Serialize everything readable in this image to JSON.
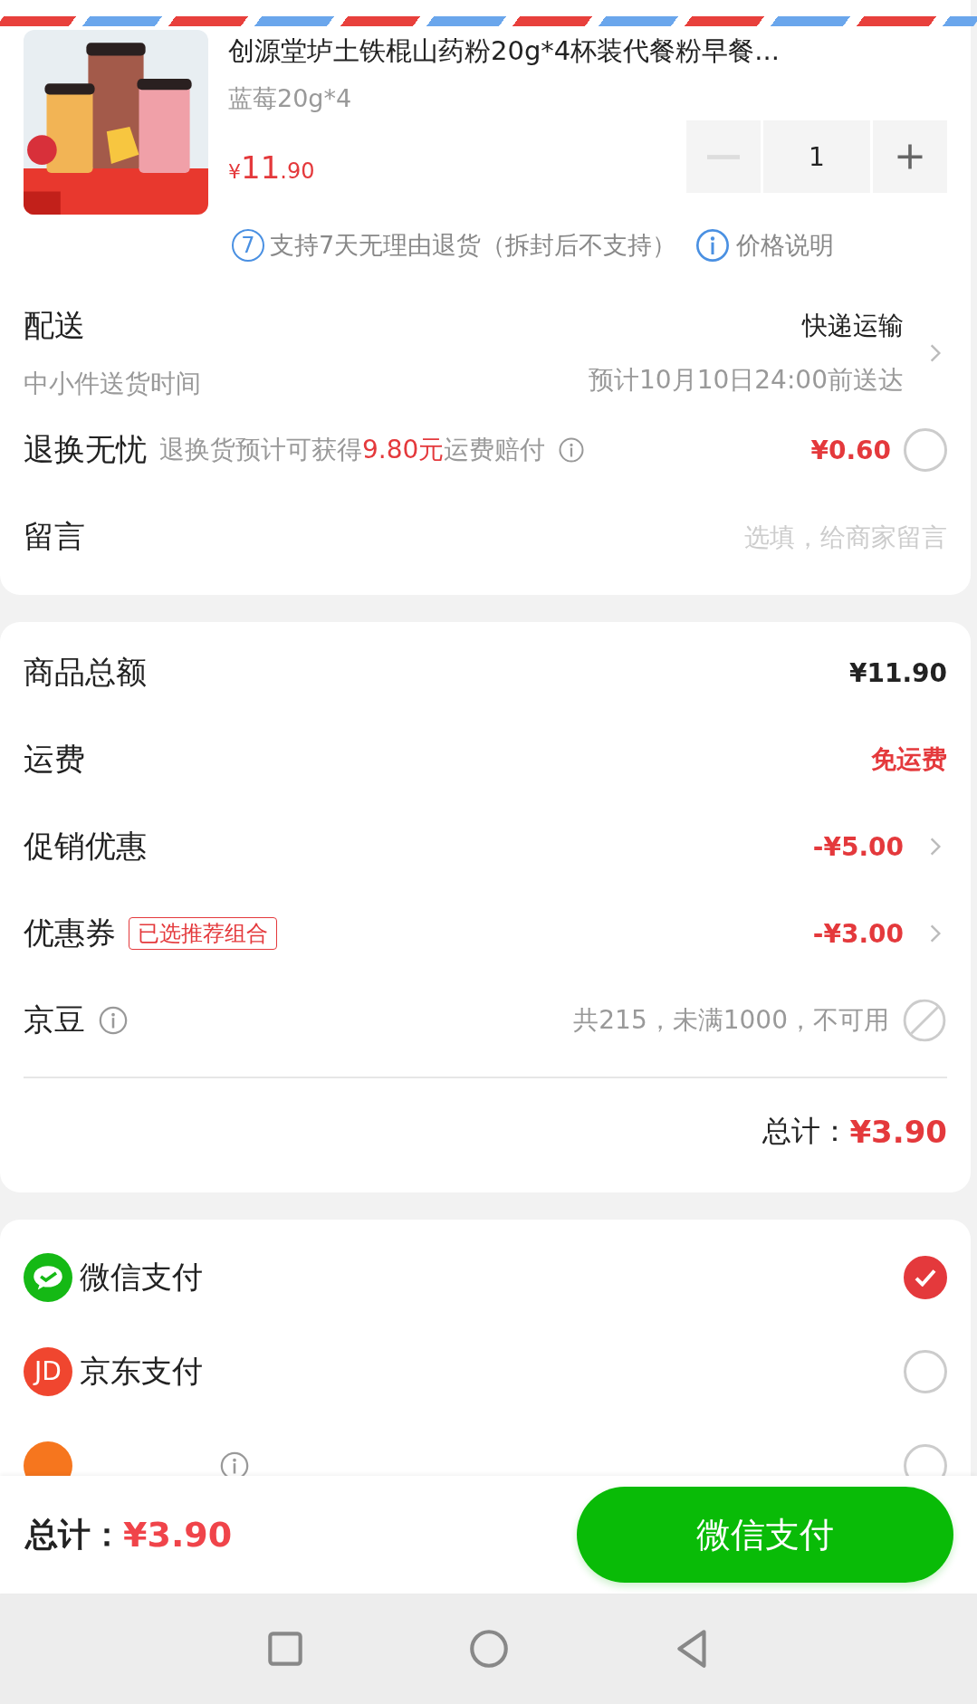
{
  "product": {
    "title": "创源堂垆土铁棍山药粉20g*4杯装代餐粉早餐...",
    "spec": "蓝莓20g*4",
    "currency": "¥",
    "price_int": "11",
    "price_dec": ".90",
    "quantity": "1",
    "minus_disabled": true,
    "returns_badge": "7",
    "returns": "支持7天无理由退货（拆封后不支持）",
    "price_note": "价格说明"
  },
  "delivery": {
    "label": "配送",
    "method": "快递运输",
    "sub_label": "中小件送货时间",
    "eta": "预计10月10日24:00前送达"
  },
  "insurance": {
    "label": "退换无忧",
    "desc_before": "退换货预计可获得",
    "desc_highlight": "9.80元",
    "desc_after": "运费赔付",
    "price": "¥0.60",
    "checked": false
  },
  "message": {
    "label": "留言",
    "placeholder": "选填，给商家留言"
  },
  "summary": {
    "rows": [
      {
        "kind": "plain",
        "label": "商品总额",
        "value": "¥11.90",
        "color": "#222222"
      },
      {
        "kind": "plain",
        "label": "运费",
        "value": "免运费",
        "color": "#e4393c"
      },
      {
        "kind": "link",
        "label": "促销优惠",
        "value": "-¥5.00",
        "color": "#e4393c"
      },
      {
        "kind": "link",
        "label": "优惠券",
        "tag": "已选推荐组合",
        "value": "-¥3.00",
        "color": "#e4393c"
      },
      {
        "kind": "disabled",
        "label": "京豆",
        "info": true,
        "value": "共215，未满1000，不可用",
        "color": "#999999"
      }
    ],
    "total_label": "总计：",
    "total": "¥3.90"
  },
  "payments": [
    {
      "kind": "wechat",
      "label": "微信支付",
      "selected": true
    },
    {
      "kind": "jd",
      "icon_text": "JD",
      "label": "京东支付",
      "selected": false
    },
    {
      "kind": "friend",
      "info": true,
      "selected": false
    }
  ],
  "footer": {
    "total_label": "总计：",
    "total": "¥3.90",
    "pay_button": "微信支付"
  }
}
